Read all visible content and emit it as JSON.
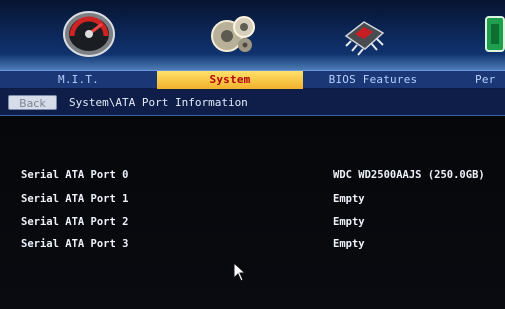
{
  "menu": {
    "items": [
      {
        "label": "M.I.T.",
        "icon": "speedometer-icon"
      },
      {
        "label": "System",
        "icon": "gears-icon",
        "active": true
      },
      {
        "label": "BIOS Features",
        "icon": "chip-icon"
      },
      {
        "label": "Per",
        "icon": "peripherals-icon"
      }
    ]
  },
  "nav": {
    "back_label": "Back",
    "breadcrumb": "System\\ATA Port Information"
  },
  "ports": [
    {
      "label": "Serial ATA Port 0",
      "value": "WDC WD2500AAJS (250.0GB)"
    },
    {
      "label": "Serial ATA Port 1",
      "value": "Empty"
    },
    {
      "label": "Serial ATA Port 2",
      "value": "Empty"
    },
    {
      "label": "Serial ATA Port 3",
      "value": "Empty"
    }
  ],
  "colors": {
    "active_tab": "#f2b12c",
    "active_text": "#b40404",
    "menu_bar": "#1b3775",
    "background": "#050608"
  }
}
